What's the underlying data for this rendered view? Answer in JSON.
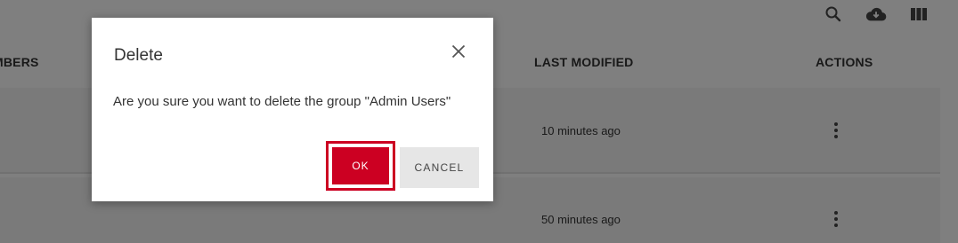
{
  "toolbar": {
    "icons": [
      "search-icon",
      "cloud-download-icon",
      "view-columns-icon"
    ]
  },
  "table": {
    "headers": {
      "members": "MBERS",
      "last_modified": "LAST MODIFIED",
      "actions": "ACTIONS"
    },
    "rows": [
      {
        "last_modified": "10 minutes ago"
      },
      {
        "last_modified": "50 minutes ago"
      }
    ]
  },
  "dialog": {
    "title": "Delete",
    "message": "Are you sure you want to delete the group \"Admin Users\"",
    "ok_label": "OK",
    "cancel_label": "CANCEL"
  },
  "colors": {
    "accent": "#cc0022",
    "overlay": "rgba(0,0,0,0.5)"
  }
}
